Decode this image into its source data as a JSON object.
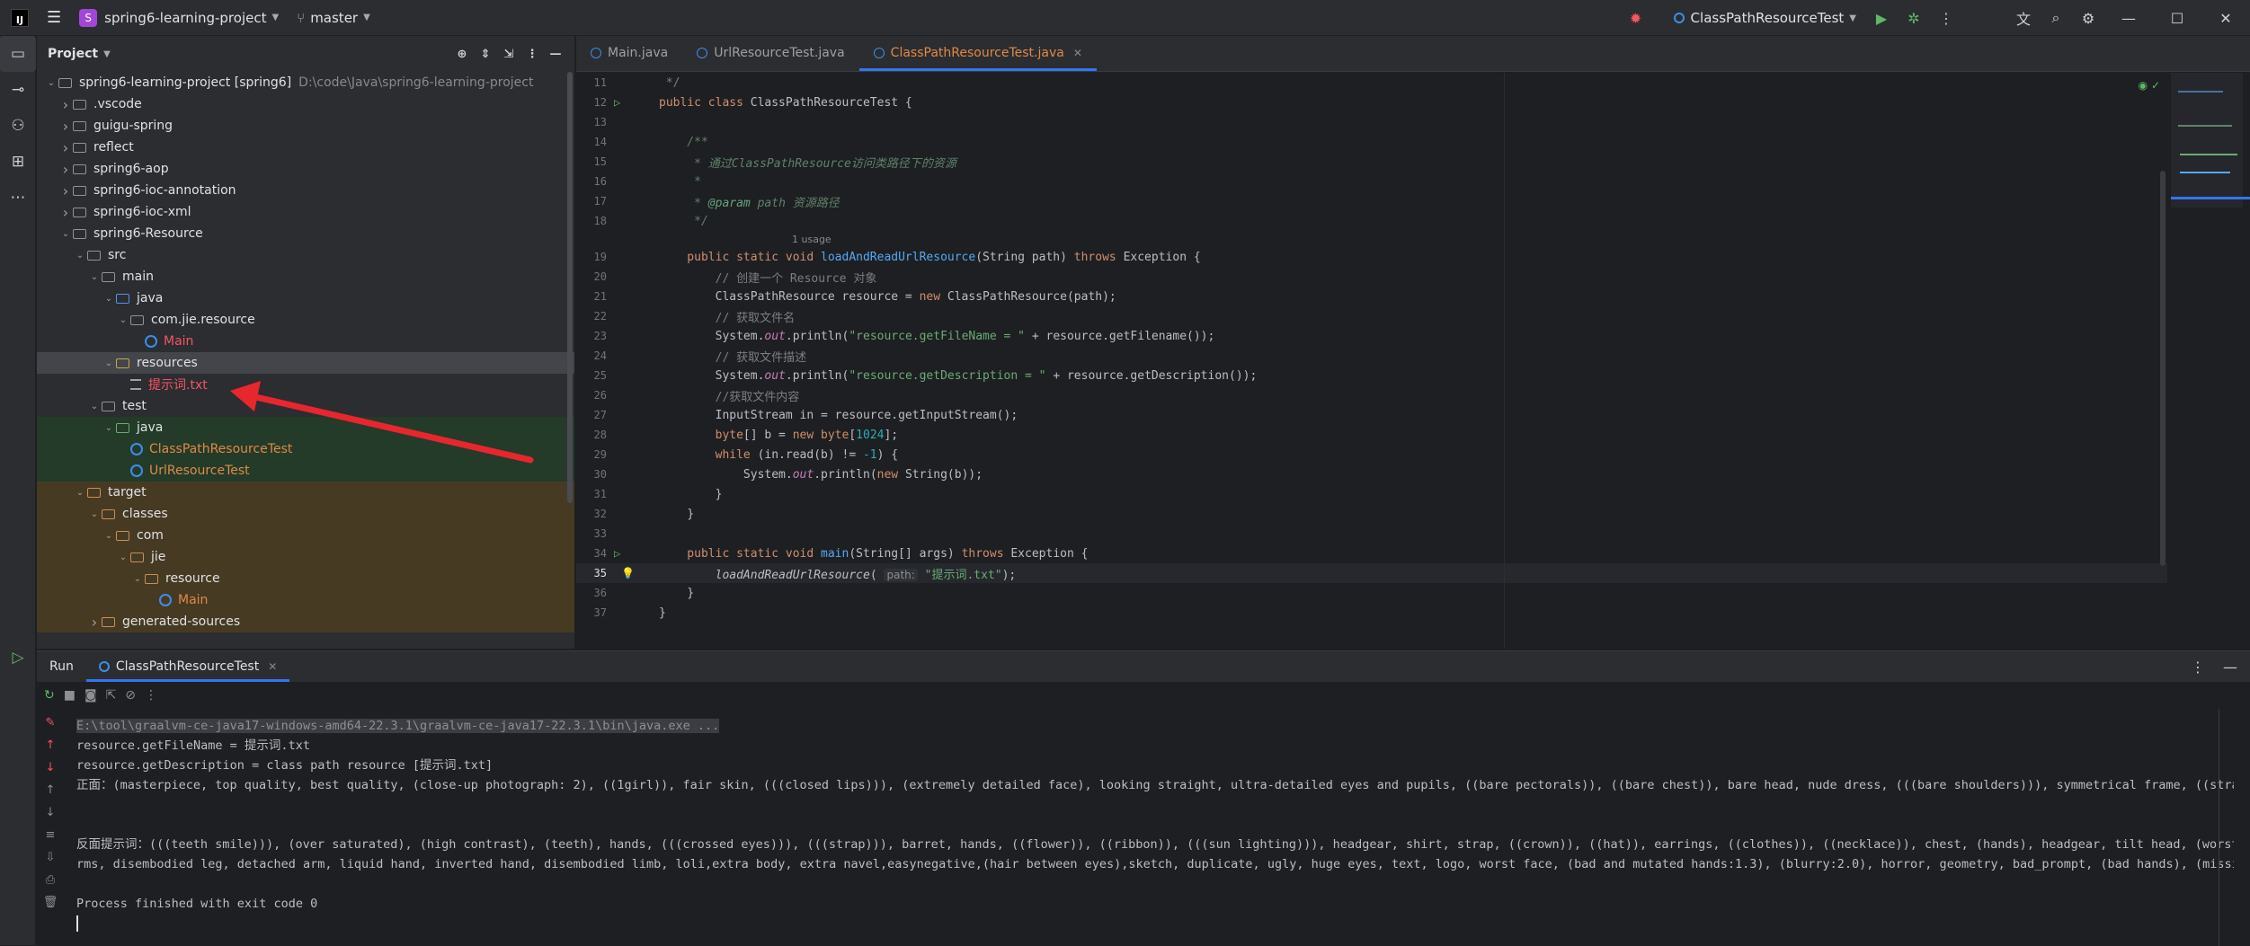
{
  "titlebar": {
    "project_badge": "S",
    "project_name": "spring6-learning-project",
    "branch": "master",
    "run_config": "ClassPathResourceTest"
  },
  "project_panel": {
    "title": "Project",
    "tree": [
      {
        "label": "spring6-learning-project [spring6]",
        "path": "D:\\code\\Java\\spring6-learning-project",
        "level": 0,
        "arrow": "down",
        "icon": "folder"
      },
      {
        "label": ".vscode",
        "level": 1,
        "arrow": "right",
        "icon": "folder"
      },
      {
        "label": "guigu-spring",
        "level": 1,
        "arrow": "right",
        "icon": "folder"
      },
      {
        "label": "reflect",
        "level": 1,
        "arrow": "right",
        "icon": "folder"
      },
      {
        "label": "spring6-aop",
        "level": 1,
        "arrow": "right",
        "icon": "folder"
      },
      {
        "label": "spring6-ioc-annotation",
        "level": 1,
        "arrow": "right",
        "icon": "folder"
      },
      {
        "label": "spring6-ioc-xml",
        "level": 1,
        "arrow": "right",
        "icon": "folder"
      },
      {
        "label": "spring6-Resource",
        "level": 1,
        "arrow": "down",
        "icon": "folder"
      },
      {
        "label": "src",
        "level": 2,
        "arrow": "down",
        "icon": "folder"
      },
      {
        "label": "main",
        "level": 3,
        "arrow": "down",
        "icon": "folder"
      },
      {
        "label": "java",
        "level": 4,
        "arrow": "down",
        "icon": "folder-src"
      },
      {
        "label": "com.jie.resource",
        "level": 5,
        "arrow": "down",
        "icon": "folder"
      },
      {
        "label": "Main",
        "level": 6,
        "arrow": "",
        "icon": "class",
        "color": "red"
      },
      {
        "label": "resources",
        "level": 4,
        "arrow": "down",
        "icon": "folder-res",
        "selected": true
      },
      {
        "label": "提示词.txt",
        "level": 5,
        "arrow": "",
        "icon": "file",
        "color": "red"
      },
      {
        "label": "test",
        "level": 3,
        "arrow": "down",
        "icon": "folder"
      },
      {
        "label": "java",
        "level": 4,
        "arrow": "down",
        "icon": "folder-test",
        "band": "green"
      },
      {
        "label": "ClassPathResourceTest",
        "level": 5,
        "arrow": "",
        "icon": "class",
        "color": "orange",
        "band": "green"
      },
      {
        "label": "UrlResourceTest",
        "level": 5,
        "arrow": "",
        "icon": "class",
        "color": "orange",
        "band": "green"
      },
      {
        "label": "target",
        "level": 2,
        "arrow": "down",
        "icon": "folder-excl",
        "band": "orange"
      },
      {
        "label": "classes",
        "level": 3,
        "arrow": "down",
        "icon": "folder-excl",
        "band": "orange"
      },
      {
        "label": "com",
        "level": 4,
        "arrow": "down",
        "icon": "folder-excl",
        "band": "orange"
      },
      {
        "label": "jie",
        "level": 5,
        "arrow": "down",
        "icon": "folder-excl",
        "band": "orange"
      },
      {
        "label": "resource",
        "level": 6,
        "arrow": "down",
        "icon": "folder-excl",
        "band": "orange"
      },
      {
        "label": "Main",
        "level": 7,
        "arrow": "",
        "icon": "class",
        "color": "orange",
        "band": "orange"
      },
      {
        "label": "generated-sources",
        "level": 3,
        "arrow": "right",
        "icon": "folder-excl",
        "band": "orange"
      }
    ]
  },
  "editor": {
    "tabs": [
      {
        "label": "Main.java",
        "active": false
      },
      {
        "label": "UrlResourceTest.java",
        "active": false
      },
      {
        "label": "ClassPathResourceTest.java",
        "active": true
      }
    ],
    "usage_hint": "1 usage",
    "param_hint": "path:",
    "lines": [
      {
        "n": "11",
        "tokens": [
          [
            "cm",
            " */"
          ]
        ]
      },
      {
        "n": "12",
        "run": true,
        "tokens": [
          [
            "kw",
            "public class "
          ],
          [
            "",
            "ClassPathResourceTest {"
          ]
        ]
      },
      {
        "n": "13",
        "tokens": []
      },
      {
        "n": "14",
        "tokens": [
          [
            "dc",
            "    /**"
          ]
        ]
      },
      {
        "n": "15",
        "tokens": [
          [
            "dc",
            "     * 通过ClassPathResource访问类路径下的资源"
          ]
        ]
      },
      {
        "n": "16",
        "tokens": [
          [
            "dc",
            "     *"
          ]
        ]
      },
      {
        "n": "17",
        "tokens": [
          [
            "dc",
            "     * "
          ],
          [
            "tg",
            "@param"
          ],
          [
            "dc",
            " path 资源路径"
          ]
        ]
      },
      {
        "n": "18",
        "tokens": [
          [
            "dc",
            "     */"
          ]
        ]
      },
      {
        "n": "19",
        "tokens": [
          [
            "kw",
            "    public static void "
          ],
          [
            "fn",
            "loadAndReadUrlResource"
          ],
          [
            "",
            "(String path) "
          ],
          [
            "kw",
            "throws "
          ],
          [
            "",
            "Exception {"
          ]
        ]
      },
      {
        "n": "20",
        "tokens": [
          [
            "cm",
            "        // 创建一个 Resource 对象"
          ]
        ]
      },
      {
        "n": "21",
        "tokens": [
          [
            "",
            "        ClassPathResource resource = "
          ],
          [
            "kw",
            "new "
          ],
          [
            "",
            "ClassPathResource(path);"
          ]
        ]
      },
      {
        "n": "22",
        "tokens": [
          [
            "cm",
            "        // 获取文件名"
          ]
        ]
      },
      {
        "n": "23",
        "tokens": [
          [
            "",
            "        System."
          ],
          [
            "fld",
            "out"
          ],
          [
            "",
            ".println("
          ],
          [
            "st",
            "\"resource.getFileName = \""
          ],
          [
            "",
            " + resource.getFilename());"
          ]
        ]
      },
      {
        "n": "24",
        "tokens": [
          [
            "cm",
            "        // 获取文件描述"
          ]
        ]
      },
      {
        "n": "25",
        "tokens": [
          [
            "",
            "        System."
          ],
          [
            "fld",
            "out"
          ],
          [
            "",
            ".println("
          ],
          [
            "st",
            "\"resource.getDescription = \""
          ],
          [
            "",
            " + resource.getDescription());"
          ]
        ]
      },
      {
        "n": "26",
        "tokens": [
          [
            "cm",
            "        //获取文件内容"
          ]
        ]
      },
      {
        "n": "27",
        "tokens": [
          [
            "",
            "        InputStream in = resource.getInputStream();"
          ]
        ]
      },
      {
        "n": "28",
        "tokens": [
          [
            "kw",
            "        byte"
          ],
          [
            "",
            "[] b = "
          ],
          [
            "kw",
            "new byte"
          ],
          [
            "",
            "["
          ],
          [
            "num",
            "1024"
          ],
          [
            "",
            "];"
          ]
        ]
      },
      {
        "n": "29",
        "tokens": [
          [
            "kw",
            "        while "
          ],
          [
            "",
            "(in.read(b) != "
          ],
          [
            "num",
            "-1"
          ],
          [
            "",
            ") {"
          ]
        ]
      },
      {
        "n": "30",
        "tokens": [
          [
            "",
            "            System."
          ],
          [
            "fld",
            "out"
          ],
          [
            "",
            ".println("
          ],
          [
            "kw",
            "new "
          ],
          [
            "",
            "String(b));"
          ]
        ]
      },
      {
        "n": "31",
        "tokens": [
          [
            "",
            "        }"
          ]
        ]
      },
      {
        "n": "32",
        "tokens": [
          [
            "",
            "    }"
          ]
        ]
      },
      {
        "n": "33",
        "tokens": []
      },
      {
        "n": "34",
        "run": true,
        "tokens": [
          [
            "kw",
            "    public static void "
          ],
          [
            "fn",
            "main"
          ],
          [
            "",
            "(String[] args) "
          ],
          [
            "kw",
            "throws "
          ],
          [
            "",
            "Exception {"
          ]
        ]
      },
      {
        "n": "35",
        "current": true,
        "bulb": true,
        "tokens": [
          [
            "it",
            "        loadAndReadUrlResource"
          ],
          [
            "",
            "( "
          ],
          [
            "hint",
            "path:"
          ],
          [
            "st",
            " \"提示词.txt\""
          ],
          [
            "",
            ");"
          ]
        ]
      },
      {
        "n": "36",
        "tokens": [
          [
            "",
            "    }"
          ]
        ]
      },
      {
        "n": "37",
        "tokens": [
          [
            "",
            "}"
          ]
        ]
      }
    ]
  },
  "run_panel": {
    "label": "Run",
    "tab": "ClassPathResourceTest",
    "console": [
      "E:\\tool\\graalvm-ce-java17-windows-amd64-22.3.1\\graalvm-ce-java17-22.3.1\\bin\\java.exe ...",
      "resource.getFileName = 提示词.txt",
      "resource.getDescription = class path resource [提示词.txt]",
      "正面：(masterpiece, top quality, best quality, (close-up photograph: 2), ((1girl)), fair skin, (((closed lips))), (extremely detailed face), looking straight, ultra-detailed eyes and pupils, ((bare pectorals)), ((bare chest)), bare head, nude dress, (((bare shoulders))), symmetrical frame, ((strapl",
      "",
      "",
      "反面提示词：(((teeth smile))), (over saturated), (high contrast), (teeth), hands, (((crossed eyes))), (((strap))), barret, hands, ((flower)), ((ribbon)), (((sun lighting))), headgear, shirt, strap, ((crown)), ((hat)), earrings, ((clothes)), ((necklace)), chest, (hands), headgear, tilt head, (worst q",
      "rms, disembodied leg, detached arm, liquid hand, inverted hand, disembodied limb, loli,extra body, extra navel,easynegative,(hair between eyes),sketch, duplicate, ugly, huge eyes, text, logo, worst face, (bad and mutated hands:1.3), (blurry:2.0), horror, geometry, bad_prompt, (bad hands), (missing",
      "",
      "Process finished with exit code 0"
    ]
  },
  "colors": {
    "accent": "#3574f0",
    "arrow_annotation": "#e8262e"
  }
}
